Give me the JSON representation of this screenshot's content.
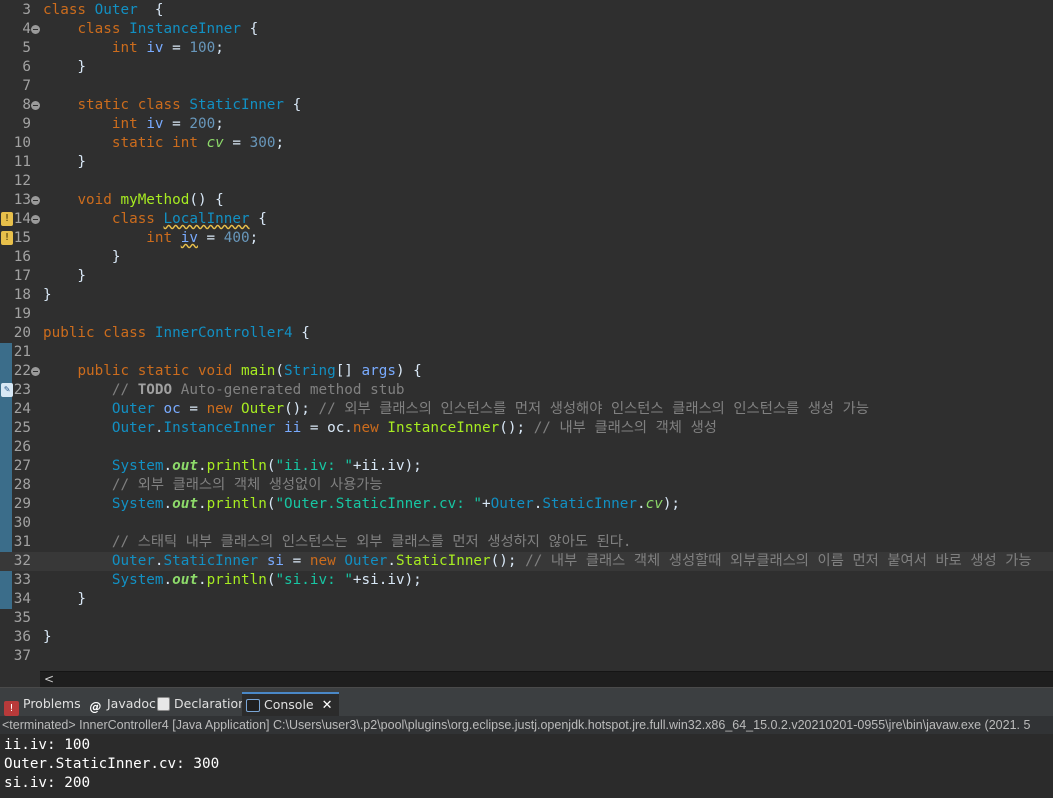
{
  "editor": {
    "lines": [
      {
        "n": "3",
        "tokens": [
          [
            "kw",
            "class "
          ],
          [
            "ty",
            "Outer"
          ],
          [
            "",
            "  {"
          ]
        ]
      },
      {
        "n": "4",
        "fold": true,
        "tokens": [
          [
            "",
            "    "
          ],
          [
            "kw",
            "class "
          ],
          [
            "ty",
            "InstanceInner"
          ],
          [
            "",
            " {"
          ]
        ]
      },
      {
        "n": "5",
        "tokens": [
          [
            "",
            "        "
          ],
          [
            "kw",
            "int "
          ],
          [
            "var",
            "iv"
          ],
          [
            "",
            " = "
          ],
          [
            "nm",
            "100"
          ],
          [
            "",
            ";"
          ]
        ]
      },
      {
        "n": "6",
        "tokens": [
          [
            "",
            "    }"
          ]
        ]
      },
      {
        "n": "7",
        "tokens": []
      },
      {
        "n": "8",
        "fold": true,
        "tokens": [
          [
            "",
            "    "
          ],
          [
            "kw",
            "static class "
          ],
          [
            "ty",
            "StaticInner"
          ],
          [
            "",
            " {"
          ]
        ]
      },
      {
        "n": "9",
        "tokens": [
          [
            "",
            "        "
          ],
          [
            "kw",
            "int "
          ],
          [
            "var",
            "iv"
          ],
          [
            "",
            " = "
          ],
          [
            "nm",
            "200"
          ],
          [
            "",
            ";"
          ]
        ]
      },
      {
        "n": "10",
        "tokens": [
          [
            "",
            "        "
          ],
          [
            "kw",
            "static int "
          ],
          [
            "fi",
            "cv"
          ],
          [
            "",
            " = "
          ],
          [
            "nm",
            "300"
          ],
          [
            "",
            ";"
          ]
        ]
      },
      {
        "n": "11",
        "tokens": [
          [
            "",
            "    }"
          ]
        ]
      },
      {
        "n": "12",
        "tokens": []
      },
      {
        "n": "13",
        "fold": true,
        "tokens": [
          [
            "",
            "    "
          ],
          [
            "kw",
            "void "
          ],
          [
            "fn",
            "myMethod"
          ],
          [
            "",
            "() {"
          ]
        ]
      },
      {
        "n": "14",
        "fold": true,
        "marker": "warn",
        "tokens": [
          [
            "",
            "        "
          ],
          [
            "kw",
            "class "
          ],
          [
            "ty squig",
            "LocalInner"
          ],
          [
            "",
            " {"
          ]
        ]
      },
      {
        "n": "15",
        "marker": "warn",
        "tokens": [
          [
            "",
            "            "
          ],
          [
            "kw",
            "int "
          ],
          [
            "var squig",
            "iv"
          ],
          [
            "",
            " = "
          ],
          [
            "nm",
            "400"
          ],
          [
            "",
            ";"
          ]
        ]
      },
      {
        "n": "16",
        "tokens": [
          [
            "",
            "        }"
          ]
        ]
      },
      {
        "n": "17",
        "tokens": [
          [
            "",
            "    }"
          ]
        ]
      },
      {
        "n": "18",
        "tokens": [
          [
            "",
            "}"
          ]
        ]
      },
      {
        "n": "19",
        "tokens": []
      },
      {
        "n": "20",
        "tokens": [
          [
            "kw",
            "public class "
          ],
          [
            "ty",
            "InnerController4"
          ],
          [
            "",
            " {"
          ]
        ]
      },
      {
        "n": "21",
        "tokens": []
      },
      {
        "n": "22",
        "fold": true,
        "tokens": [
          [
            "",
            "    "
          ],
          [
            "kw",
            "public static void "
          ],
          [
            "fn",
            "main"
          ],
          [
            "",
            "("
          ],
          [
            "ty",
            "String"
          ],
          [
            "",
            "[] "
          ],
          [
            "var",
            "args"
          ],
          [
            "",
            ") {"
          ]
        ]
      },
      {
        "n": "23",
        "marker": "task",
        "tokens": [
          [
            "",
            "        "
          ],
          [
            "cm",
            "// "
          ],
          [
            "bold",
            "TODO"
          ],
          [
            "cm",
            " Auto-generated method stub"
          ]
        ]
      },
      {
        "n": "24",
        "tokens": [
          [
            "",
            "        "
          ],
          [
            "ty",
            "Outer "
          ],
          [
            "var",
            "oc"
          ],
          [
            "",
            " = "
          ],
          [
            "kw",
            "new "
          ],
          [
            "fn",
            "Outer"
          ],
          [
            "",
            "(); "
          ],
          [
            "cm",
            "// 외부 클래스의 인스턴스를 먼저 생성해야 인스턴스 클래스의 인스턴스를 생성 가능"
          ]
        ]
      },
      {
        "n": "25",
        "tokens": [
          [
            "",
            "        "
          ],
          [
            "ty",
            "Outer"
          ],
          [
            "",
            "."
          ],
          [
            "ty",
            "InstanceInner "
          ],
          [
            "var",
            "ii"
          ],
          [
            "",
            " = "
          ],
          [
            "",
            "oc."
          ],
          [
            "kw",
            "new "
          ],
          [
            "fn",
            "InstanceInner"
          ],
          [
            "",
            "(); "
          ],
          [
            "cm",
            "// 내부 클래스의 객체 생성"
          ]
        ]
      },
      {
        "n": "26",
        "tokens": []
      },
      {
        "n": "27",
        "tokens": [
          [
            "",
            "        "
          ],
          [
            "ty",
            "System"
          ],
          [
            "",
            "."
          ],
          [
            "sf",
            "out"
          ],
          [
            "",
            "."
          ],
          [
            "fn",
            "println"
          ],
          [
            "",
            "("
          ],
          [
            "st",
            "\"ii.iv: \""
          ],
          [
            "",
            "+ii.iv);"
          ]
        ]
      },
      {
        "n": "28",
        "tokens": [
          [
            "",
            "        "
          ],
          [
            "cm",
            "// 외부 클래스의 객체 생성없이 사용가능"
          ]
        ]
      },
      {
        "n": "29",
        "tokens": [
          [
            "",
            "        "
          ],
          [
            "ty",
            "System"
          ],
          [
            "",
            "."
          ],
          [
            "sf",
            "out"
          ],
          [
            "",
            "."
          ],
          [
            "fn",
            "println"
          ],
          [
            "",
            "("
          ],
          [
            "st",
            "\"Outer.StaticInner.cv: \""
          ],
          [
            "",
            "+"
          ],
          [
            "ty",
            "Outer"
          ],
          [
            "",
            "."
          ],
          [
            "ty",
            "StaticInner"
          ],
          [
            "",
            "."
          ],
          [
            "fi",
            "cv"
          ],
          [
            "",
            ");"
          ]
        ]
      },
      {
        "n": "30",
        "tokens": []
      },
      {
        "n": "31",
        "tokens": [
          [
            "",
            "        "
          ],
          [
            "cm",
            "// 스태틱 내부 클래스의 인스턴스는 외부 클래스를 먼저 생성하지 않아도 된다."
          ]
        ]
      },
      {
        "n": "32",
        "current": true,
        "tokens": [
          [
            "",
            "        "
          ],
          [
            "ty",
            "Outer"
          ],
          [
            "",
            "."
          ],
          [
            "ty",
            "StaticInner "
          ],
          [
            "var",
            "si"
          ],
          [
            "",
            " = "
          ],
          [
            "kw",
            "new "
          ],
          [
            "ty",
            "Outer"
          ],
          [
            "",
            "."
          ],
          [
            "fn",
            "StaticInner"
          ],
          [
            "",
            "(); "
          ],
          [
            "cm",
            "// 내부 클래스 객체 생성할때 외부클래스의 이름 먼저 붙여서 바로 생성 가능"
          ]
        ]
      },
      {
        "n": "33",
        "tokens": [
          [
            "",
            "        "
          ],
          [
            "ty",
            "System"
          ],
          [
            "",
            "."
          ],
          [
            "sf",
            "out"
          ],
          [
            "",
            "."
          ],
          [
            "fn",
            "println"
          ],
          [
            "",
            "("
          ],
          [
            "st",
            "\"si.iv: \""
          ],
          [
            "",
            "+si.iv);"
          ]
        ]
      },
      {
        "n": "34",
        "tokens": [
          [
            "",
            "    }"
          ]
        ]
      },
      {
        "n": "35",
        "tokens": []
      },
      {
        "n": "36",
        "tokens": [
          [
            "",
            "}"
          ]
        ]
      },
      {
        "n": "37",
        "tokens": []
      }
    ]
  },
  "scroll": {
    "left_arrow": "<"
  },
  "tabs": {
    "problems": "Problems",
    "javadoc": "Javadoc",
    "declaration": "Declaration",
    "console": "Console",
    "close": "✕"
  },
  "console": {
    "header": "<terminated> InnerController4 [Java Application] C:\\Users\\user3\\.p2\\pool\\plugins\\org.eclipse.justj.openjdk.hotspot.jre.full.win32.x86_64_15.0.2.v20210201-0955\\jre\\bin\\javaw.exe  (2021. 5",
    "output": [
      "ii.iv: 100",
      "Outer.StaticInner.cv: 300",
      "si.iv: 200"
    ]
  },
  "colors": {
    "editor_bg": "#2f2f2f",
    "keyword": "#cc6c1d",
    "type": "#1290c3",
    "method": "#a7ec21",
    "number": "#6897bb",
    "string": "#17c6a3",
    "comment": "#808080"
  },
  "icons": {
    "problems": "problems-icon",
    "javadoc": "javadoc-icon",
    "declaration": "declaration-icon",
    "console": "console-icon",
    "warning": "warning-icon",
    "task": "task-icon"
  }
}
